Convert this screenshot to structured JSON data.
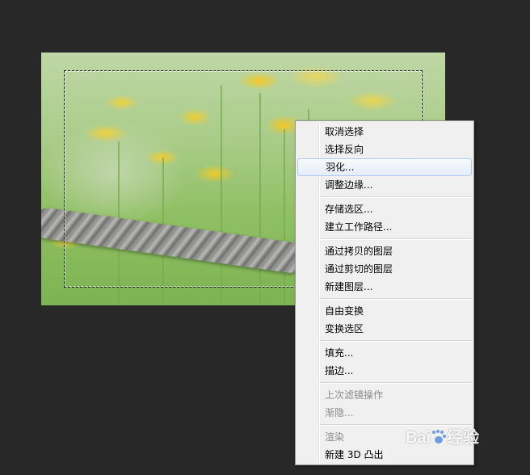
{
  "colors": {
    "background": "#282828",
    "menu_background": "#f0f0f0",
    "menu_highlight_border": "#aecaf0",
    "disabled_text": "#8a8a8a"
  },
  "context_menu": {
    "groups": [
      [
        {
          "label": "取消选择",
          "enabled": true
        },
        {
          "label": "选择反向",
          "enabled": true
        },
        {
          "label": "羽化...",
          "enabled": true,
          "highlighted": true
        },
        {
          "label": "调整边缘...",
          "enabled": true
        }
      ],
      [
        {
          "label": "存储选区...",
          "enabled": true
        },
        {
          "label": "建立工作路径...",
          "enabled": true
        }
      ],
      [
        {
          "label": "通过拷贝的图层",
          "enabled": true
        },
        {
          "label": "通过剪切的图层",
          "enabled": true
        },
        {
          "label": "新建图层...",
          "enabled": true
        }
      ],
      [
        {
          "label": "自由变换",
          "enabled": true
        },
        {
          "label": "变换选区",
          "enabled": true
        }
      ],
      [
        {
          "label": "填充...",
          "enabled": true
        },
        {
          "label": "描边...",
          "enabled": true
        }
      ],
      [
        {
          "label": "上次滤镜操作",
          "enabled": false
        },
        {
          "label": "渐隐...",
          "enabled": false
        }
      ],
      [
        {
          "label": "渲染",
          "enabled": false
        },
        {
          "label": "新建 3D 凸出",
          "enabled": true
        }
      ]
    ]
  },
  "watermark": {
    "text_left": "Bai",
    "text_right": "经验"
  }
}
